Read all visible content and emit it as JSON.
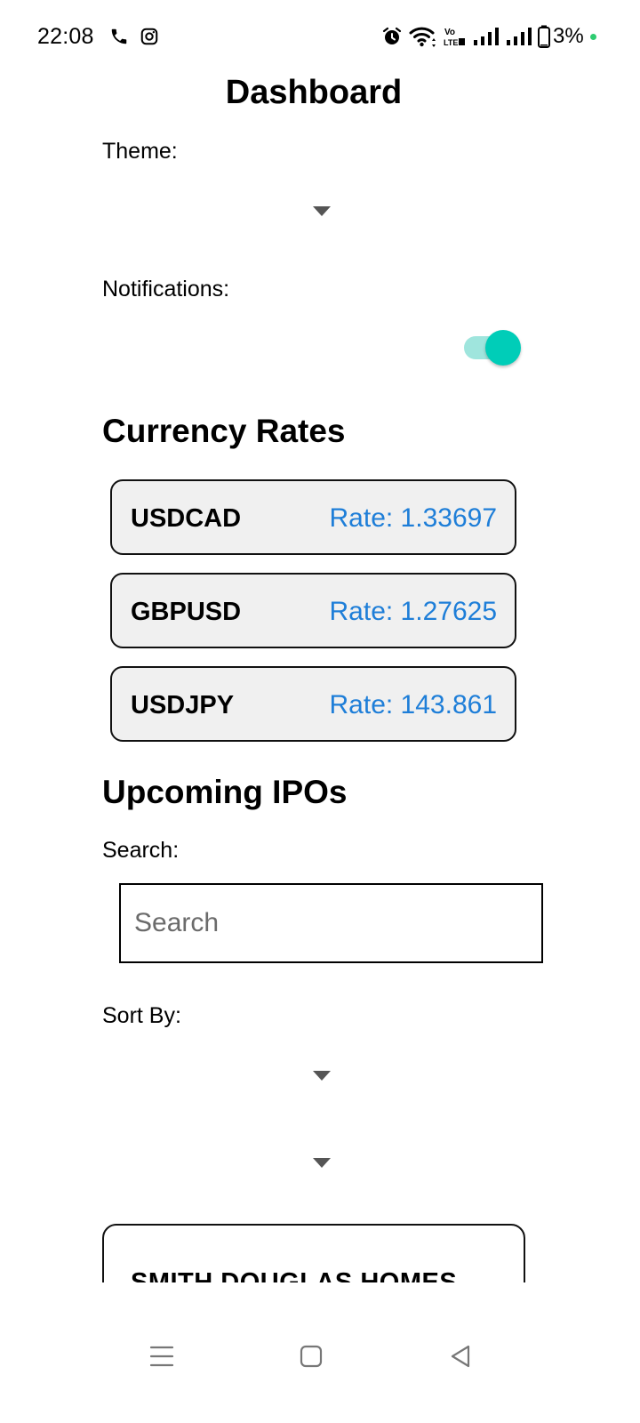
{
  "status_bar": {
    "time": "22:08",
    "battery_percent": "3%",
    "icons": [
      "phone-icon",
      "instagram-icon",
      "alarm-icon",
      "wifi-icon",
      "volte-icon",
      "signal-icon",
      "signal-icon-2",
      "battery-icon"
    ]
  },
  "header": {
    "title": "Dashboard"
  },
  "settings": {
    "theme_label": "Theme:",
    "theme_value": "",
    "notifications_label": "Notifications:",
    "notifications_enabled": true
  },
  "currency": {
    "title": "Currency Rates",
    "rates": [
      {
        "pair": "USDCAD",
        "rate": "Rate: 1.33697"
      },
      {
        "pair": "GBPUSD",
        "rate": "Rate: 1.27625"
      },
      {
        "pair": "USDJPY",
        "rate": "Rate: 143.861"
      }
    ]
  },
  "ipos": {
    "title": "Upcoming IPOs",
    "search_label": "Search:",
    "search_placeholder": "Search",
    "search_value": "",
    "sort_label": "Sort By:",
    "items": [
      {
        "name": "SMITH DOUGLAS HOMES"
      }
    ]
  },
  "colors": {
    "accent": "#00cdb8",
    "rate_text": "#1e7ed8",
    "card_bg": "#f0f0f0"
  },
  "nav": {
    "icons": [
      "menu-icon",
      "home-icon",
      "back-icon"
    ]
  }
}
